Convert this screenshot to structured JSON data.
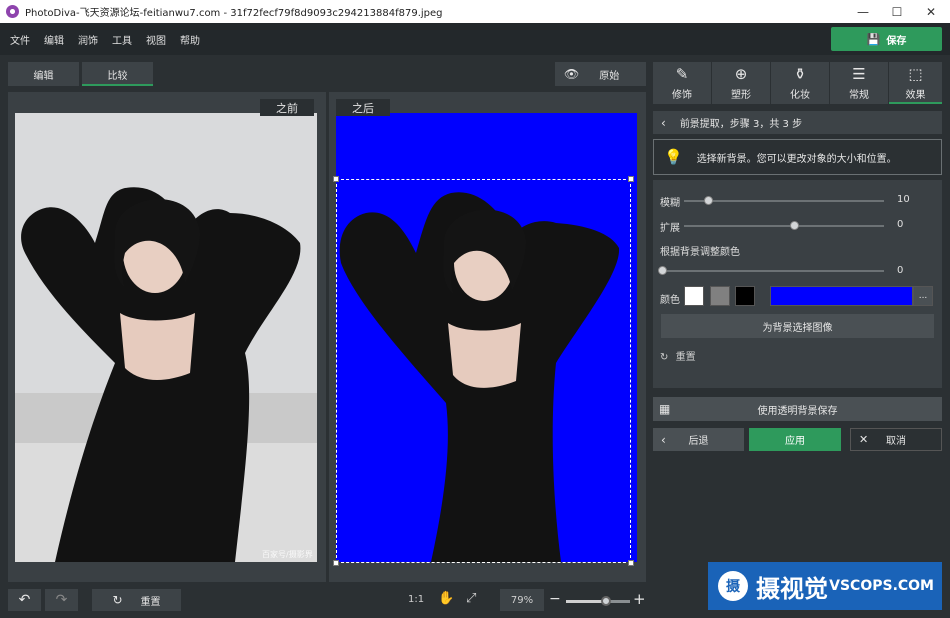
{
  "window": {
    "title": "PhotoDiva-飞天资源论坛-feitianwu7.com - 31f72fecf79f8d9093c294213884f879.jpeg",
    "minimize_icon": "minimize-icon",
    "maximize_icon": "maximize-icon",
    "close_icon": "close-icon"
  },
  "menu": [
    "文件",
    "编辑",
    "润饰",
    "工具",
    "视图",
    "帮助"
  ],
  "save_button": "保存",
  "view_tabs": {
    "edit": "编辑",
    "compare": "比较"
  },
  "original_button": "原始",
  "panels": {
    "before": "之前",
    "after": "之后"
  },
  "image_watermark": "百家号/摄影界",
  "bottom": {
    "reset": "重置",
    "one_to_one": "1:1",
    "zoom": "79%",
    "zoom_level": 0.63
  },
  "tools": [
    {
      "label": "修饰",
      "icon": "retouch-icon"
    },
    {
      "label": "塑形",
      "icon": "shape-icon"
    },
    {
      "label": "化妆",
      "icon": "makeup-icon"
    },
    {
      "label": "常规",
      "icon": "sliders-icon"
    },
    {
      "label": "效果",
      "icon": "effect-icon"
    }
  ],
  "step": "前景提取，步骤 3，共 3 步",
  "hint": "选择新背景。您可以更改对象的大小和位置。",
  "settings": {
    "blur_label": "模糊",
    "blur_value": "10",
    "blur_fraction": 0.12,
    "expand_label": "扩展",
    "expand_value": "0",
    "expand_fraction": 0.55,
    "adjust_label": "根据背景调整颜色",
    "adjust_value": "0",
    "adjust_fraction": 0.0,
    "color_label": "颜色",
    "swatches": [
      "#ffffff",
      "#808080",
      "#000000"
    ],
    "selected_color": "#0000ff",
    "more_button": "...",
    "bg_image_button": "为背景选择图像",
    "reset_link": "重置"
  },
  "transparent_save": "使用透明背景保存",
  "actions": {
    "back": "后退",
    "apply": "应用",
    "cancel": "取消"
  },
  "logo": {
    "glyph": "摄",
    "text": "摄视觉",
    "sub": "VSCOPS.COM"
  },
  "colors": {
    "accent": "#2e9a5c",
    "bg_blue": "#0000ff"
  }
}
